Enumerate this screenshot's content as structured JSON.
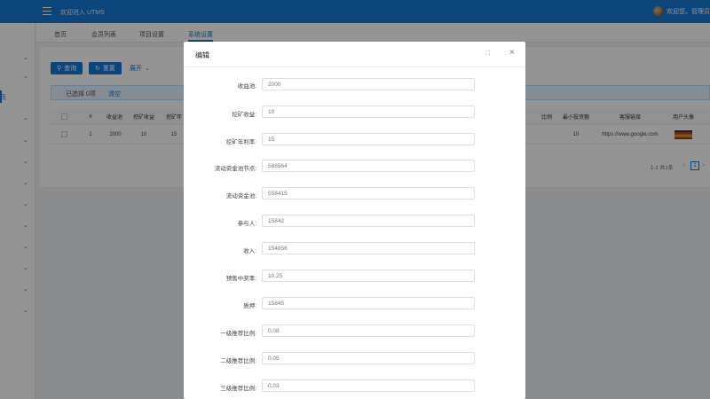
{
  "header": {
    "title": "欢迎进入 UTMS",
    "user_greeting": "欢迎您，管理员"
  },
  "sidebar": {
    "active_label": "页"
  },
  "tabs": [
    "首页",
    "会员列表",
    "项目设置",
    "系统设置"
  ],
  "toolbar": {
    "search_label": "查询",
    "reset_label": "重置",
    "expand_label": "展开"
  },
  "selection": {
    "text": "已选择 0项",
    "clear_label": "清空"
  },
  "table": {
    "headers": [
      "#",
      "收益池",
      "挖矿收益",
      "挖矿年",
      "比例",
      "最小投资额",
      "客服链接",
      "用户头像"
    ],
    "row": {
      "index": "1",
      "pool": "2000",
      "mining": "10",
      "annual": "15",
      "min_invest": "10",
      "service_link": "https://www.google.com"
    }
  },
  "pagination": {
    "summary": "1-1 共1条",
    "prev": "<",
    "current": "1",
    "next": ">"
  },
  "modal": {
    "title": "编辑",
    "fields": [
      {
        "label": "收益池:",
        "value": "2000"
      },
      {
        "label": "挖矿收益:",
        "value": "10"
      },
      {
        "label": "挖矿年利率:",
        "value": "15"
      },
      {
        "label": "流动资金池节点:",
        "value": "588564"
      },
      {
        "label": "流动资金池:",
        "value": "558415"
      },
      {
        "label": "参与人:",
        "value": "15842"
      },
      {
        "label": "收入:",
        "value": "154856"
      },
      {
        "label": "预售中奖率:",
        "value": "10.25"
      },
      {
        "label": "质押:",
        "value": "15845"
      },
      {
        "label": "一级推荐比例:",
        "value": "0.08"
      },
      {
        "label": "二级推荐比例:",
        "value": "0.05"
      },
      {
        "label": "三级推荐比例:",
        "value": "0.03"
      }
    ]
  },
  "colors": {
    "primary": "#1677d2",
    "header_bg": "#1677d2",
    "overlay": "rgba(0,0,0,0.42)"
  }
}
